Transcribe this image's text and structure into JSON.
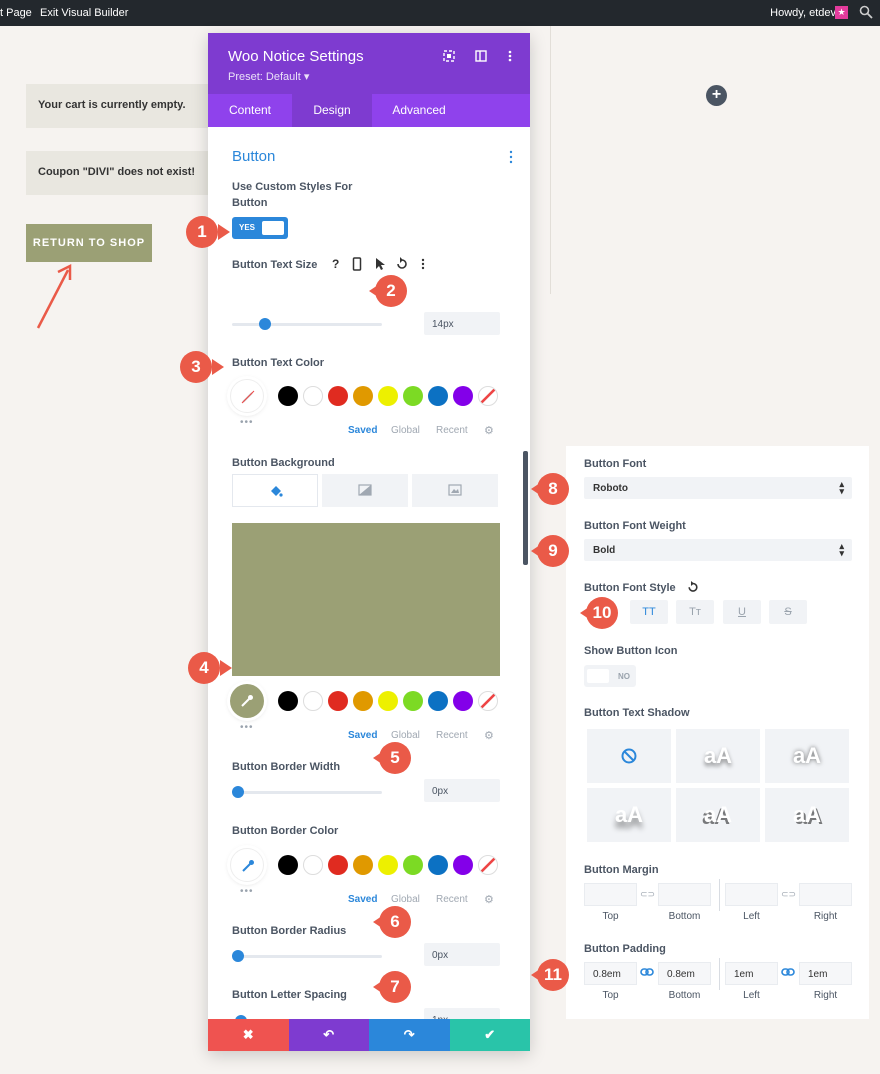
{
  "admin_bar": {
    "page_label": "t Page",
    "exit_label": "Exit Visual Builder",
    "howdy": "Howdy, etdev"
  },
  "page": {
    "notice_empty": "Your cart is currently empty.",
    "notice_coupon": "Coupon \"DIVI\" does not exist!",
    "return_button": "RETURN TO SHOP"
  },
  "modal": {
    "title": "Woo Notice Settings",
    "preset": "Preset: Default ▾",
    "tabs": [
      {
        "label": "Content"
      },
      {
        "label": "Design"
      },
      {
        "label": "Advanced"
      }
    ],
    "active_tab": "Design",
    "section_title": "Button",
    "use_custom": {
      "label_line1": "Use Custom Styles For",
      "label_line2": "Button",
      "value": "YES"
    },
    "text_size": {
      "label": "Button Text Size",
      "value": "14px",
      "slider_fraction": 0.18
    },
    "text_color": {
      "label": "Button Text Color"
    },
    "background": {
      "label": "Button Background",
      "color": "#9ba075"
    },
    "border_width": {
      "label": "Button Border Width",
      "value": "0px",
      "slider_fraction": 0.0
    },
    "border_color": {
      "label": "Button Border Color"
    },
    "border_radius": {
      "label": "Button Border Radius",
      "value": "0px",
      "slider_fraction": 0.0
    },
    "letter_spacing": {
      "label": "Button Letter Spacing",
      "value": "1px",
      "slider_fraction": 0.02
    },
    "swatches": [
      "#000000",
      "#ffffff",
      "#e02b20",
      "#e09900",
      "#edf000",
      "#7cda24",
      "#0c71c3",
      "#8300e9"
    ],
    "palette_tabs": {
      "saved": "Saved",
      "global": "Global",
      "recent": "Recent"
    },
    "footer_colors": [
      "#ef5350",
      "#7e3bd0",
      "#2b87da",
      "#29c4a9"
    ]
  },
  "right_panel": {
    "font": {
      "label": "Button Font",
      "value": "Roboto"
    },
    "weight": {
      "label": "Button Font Weight",
      "value": "Bold"
    },
    "style": {
      "label": "Button Font Style",
      "buttons": [
        "TT",
        "Tт",
        "U",
        "S"
      ]
    },
    "show_icon": {
      "label": "Show Button Icon",
      "value": "NO"
    },
    "shadow": {
      "label": "Button Text Shadow",
      "sample": "aA"
    },
    "margin": {
      "label": "Button Margin",
      "values": [
        "",
        "",
        "",
        ""
      ]
    },
    "padding": {
      "label": "Button Padding",
      "values": [
        "0.8em",
        "0.8em",
        "1em",
        "1em"
      ]
    },
    "sides": {
      "top": "Top",
      "bottom": "Bottom",
      "left": "Left",
      "right": "Right"
    }
  },
  "markers": [
    "1",
    "2",
    "3",
    "4",
    "5",
    "6",
    "7",
    "8",
    "9",
    "10",
    "11"
  ]
}
